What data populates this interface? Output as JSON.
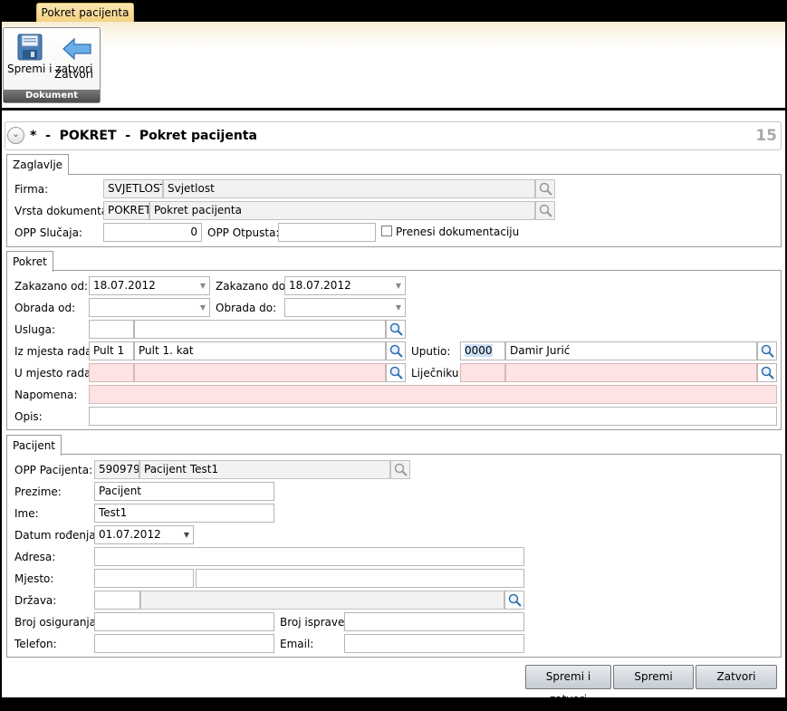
{
  "window": {
    "tab_title": "Pokret pacijenta"
  },
  "ribbon": {
    "save_close_label": "Spremi i zatvori",
    "close_label": "Zatvori",
    "group_label": "Dokument",
    "save_icon": "floppy-disk-icon",
    "close_icon": "back-arrow-icon"
  },
  "header": {
    "title": "*  -  POKRET  -  Pokret pacijenta",
    "record_number": "15"
  },
  "zaglavlje": {
    "tab_label": "Zaglavlje",
    "firma_label": "Firma:",
    "firma_code": "SVJETLOST",
    "firma_name": "Svjetlost",
    "vrsta_label": "Vrsta dokumenta:",
    "vrsta_code": "POKRET",
    "vrsta_name": "Pokret pacijenta",
    "opp_slucaja_label": "OPP Slučaja:",
    "opp_slucaja_value": "0",
    "opp_otpusta_label": "OPP Otpusta:",
    "opp_otpusta_value": "",
    "prenesi_label": "Prenesi dokumentaciju",
    "prenesi_checked": false
  },
  "pokret": {
    "tab_label": "Pokret",
    "zakazano_od_label": "Zakazano od:",
    "zakazano_od_value": "18.07.2012",
    "zakazano_do_label": "Zakazano do:",
    "zakazano_do_value": "18.07.2012",
    "obrada_od_label": "Obrada od:",
    "obrada_od_value": "",
    "obrada_do_label": "Obrada do:",
    "obrada_do_value": "",
    "usluga_label": "Usluga:",
    "usluga_code": "",
    "usluga_name": "",
    "iz_mjesta_label": "Iz mjesta rada:",
    "iz_mjesta_code": "Pult 1",
    "iz_mjesta_name": "Pult 1. kat",
    "uputio_label": "Uputio:",
    "uputio_code": "0000",
    "uputio_name": "Damir Jurić",
    "u_mjesto_label": "U mjesto rada:",
    "u_mjesto_code": "",
    "u_mjesto_name": "",
    "ljecniku_label": "Liječniku:",
    "ljecniku_code": "",
    "ljecniku_name": "",
    "napomena_label": "Napomena:",
    "napomena_value": "",
    "opis_label": "Opis:",
    "opis_value": ""
  },
  "pacijent": {
    "tab_label": "Pacijent",
    "opp_label": "OPP Pacijenta:",
    "opp_code": "590979",
    "opp_name": "Pacijent Test1",
    "prezime_label": "Prezime:",
    "prezime_value": "Pacijent",
    "ime_label": "Ime:",
    "ime_value": "Test1",
    "datum_label": "Datum rođenja:",
    "datum_value": "01.07.2012",
    "adresa_label": "Adresa:",
    "adresa_value": "",
    "mjesto_label": "Mjesto:",
    "mjesto_code": "",
    "mjesto_name": "",
    "drzava_label": "Država:",
    "drzava_code": "",
    "drzava_name": "",
    "broj_osig_label": "Broj osiguranja:",
    "broj_osig_value": "",
    "broj_isprave_label": "Broj isprave:",
    "broj_isprave_value": "",
    "telefon_label": "Telefon:",
    "telefon_value": "",
    "email_label": "Email:",
    "email_value": ""
  },
  "footer": {
    "save_close_label": "Spremi i zatvori",
    "save_label": "Spremi",
    "close_label": "Zatvori"
  },
  "colors": {
    "required_bg": "#fde3e3",
    "readonly_bg": "#f2f2f2",
    "tab_active": "#f4d184"
  }
}
